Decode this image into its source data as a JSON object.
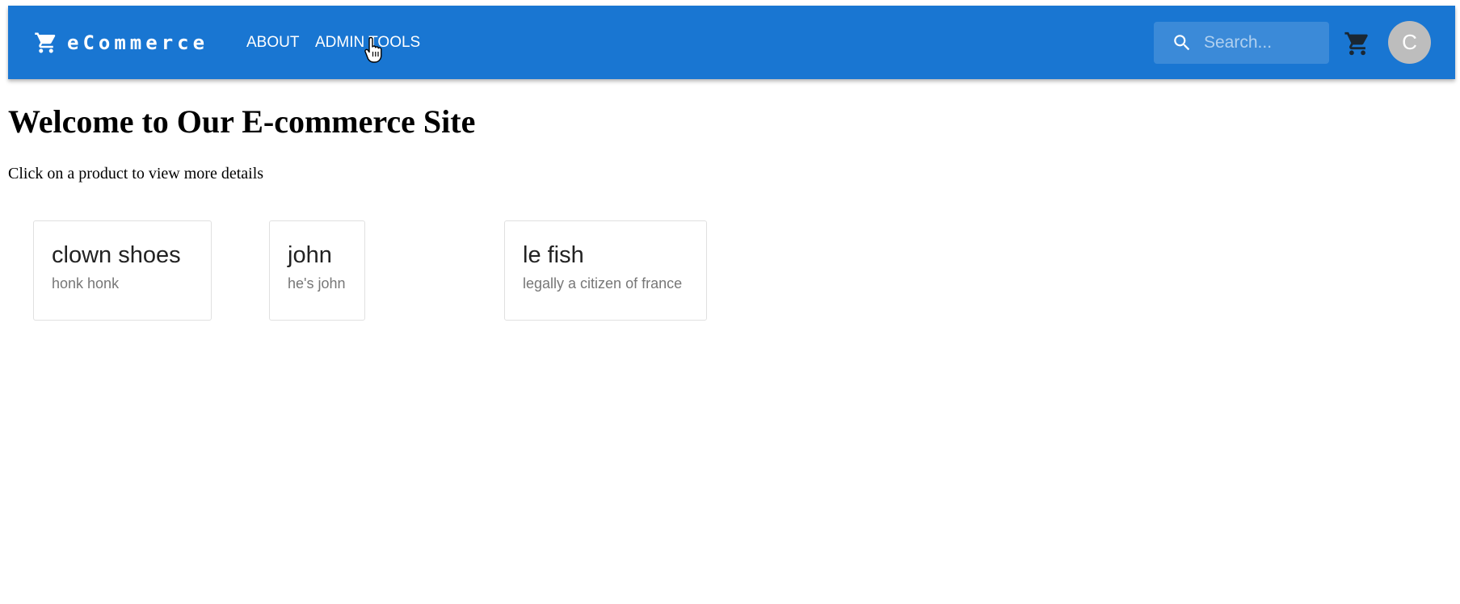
{
  "header": {
    "brand": "eCommerce",
    "brand_icon": "shopping-cart-icon",
    "nav": [
      {
        "label": "ABOUT"
      },
      {
        "label": "ADMIN TOOLS"
      }
    ],
    "search": {
      "placeholder": "Search...",
      "value": "",
      "icon": "search-icon"
    },
    "cart_icon": "shopping-cart-icon",
    "avatar_letter": "C"
  },
  "colors": {
    "appbar": "#1976d2",
    "avatar": "#bdbdbd"
  },
  "main": {
    "title": "Welcome to Our E-commerce Site",
    "subtitle": "Click on a product to view more details",
    "products": [
      {
        "name": "clown shoes",
        "description": "honk honk"
      },
      {
        "name": "john",
        "description": "he's john"
      },
      {
        "name": "le fish",
        "description": "legally a citizen of france"
      }
    ]
  }
}
